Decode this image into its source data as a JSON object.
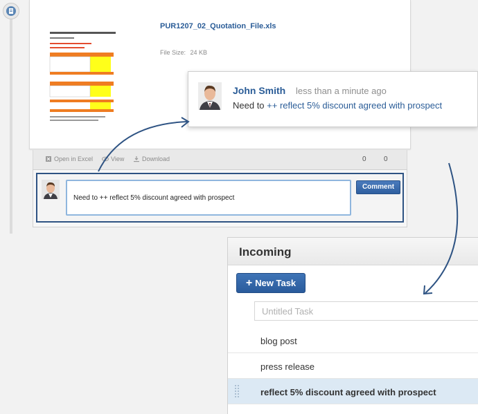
{
  "file": {
    "title": "PUR1207_02_Quotation_File.xls",
    "size_label": "File Size:",
    "size_value": "24 KB"
  },
  "actions": {
    "open_excel": "Open in Excel",
    "view": "View",
    "download": "Download",
    "comments_count": "0",
    "likes_count": "0"
  },
  "comment": {
    "input_value": "Need to ++ reflect 5% discount agreed with prospect",
    "button_label": "Comment"
  },
  "popup": {
    "name": "John Smith",
    "time": "less than a minute ago",
    "text_prefix": "Need to ",
    "text_tag": "++ reflect 5% discount agreed with prospect"
  },
  "tasks": {
    "header": "Incoming",
    "new_task_label": "New Task",
    "new_task_icon": "+",
    "input_placeholder": "Untitled Task",
    "items": [
      {
        "label": "blog post"
      },
      {
        "label": "press release"
      },
      {
        "label": "reflect 5% discount agreed with prospect"
      }
    ]
  },
  "colors": {
    "accent": "#2a5c97",
    "button": "#2f5f9f",
    "highlight_row": "#dce9f4",
    "arrow": "#2e5383"
  }
}
